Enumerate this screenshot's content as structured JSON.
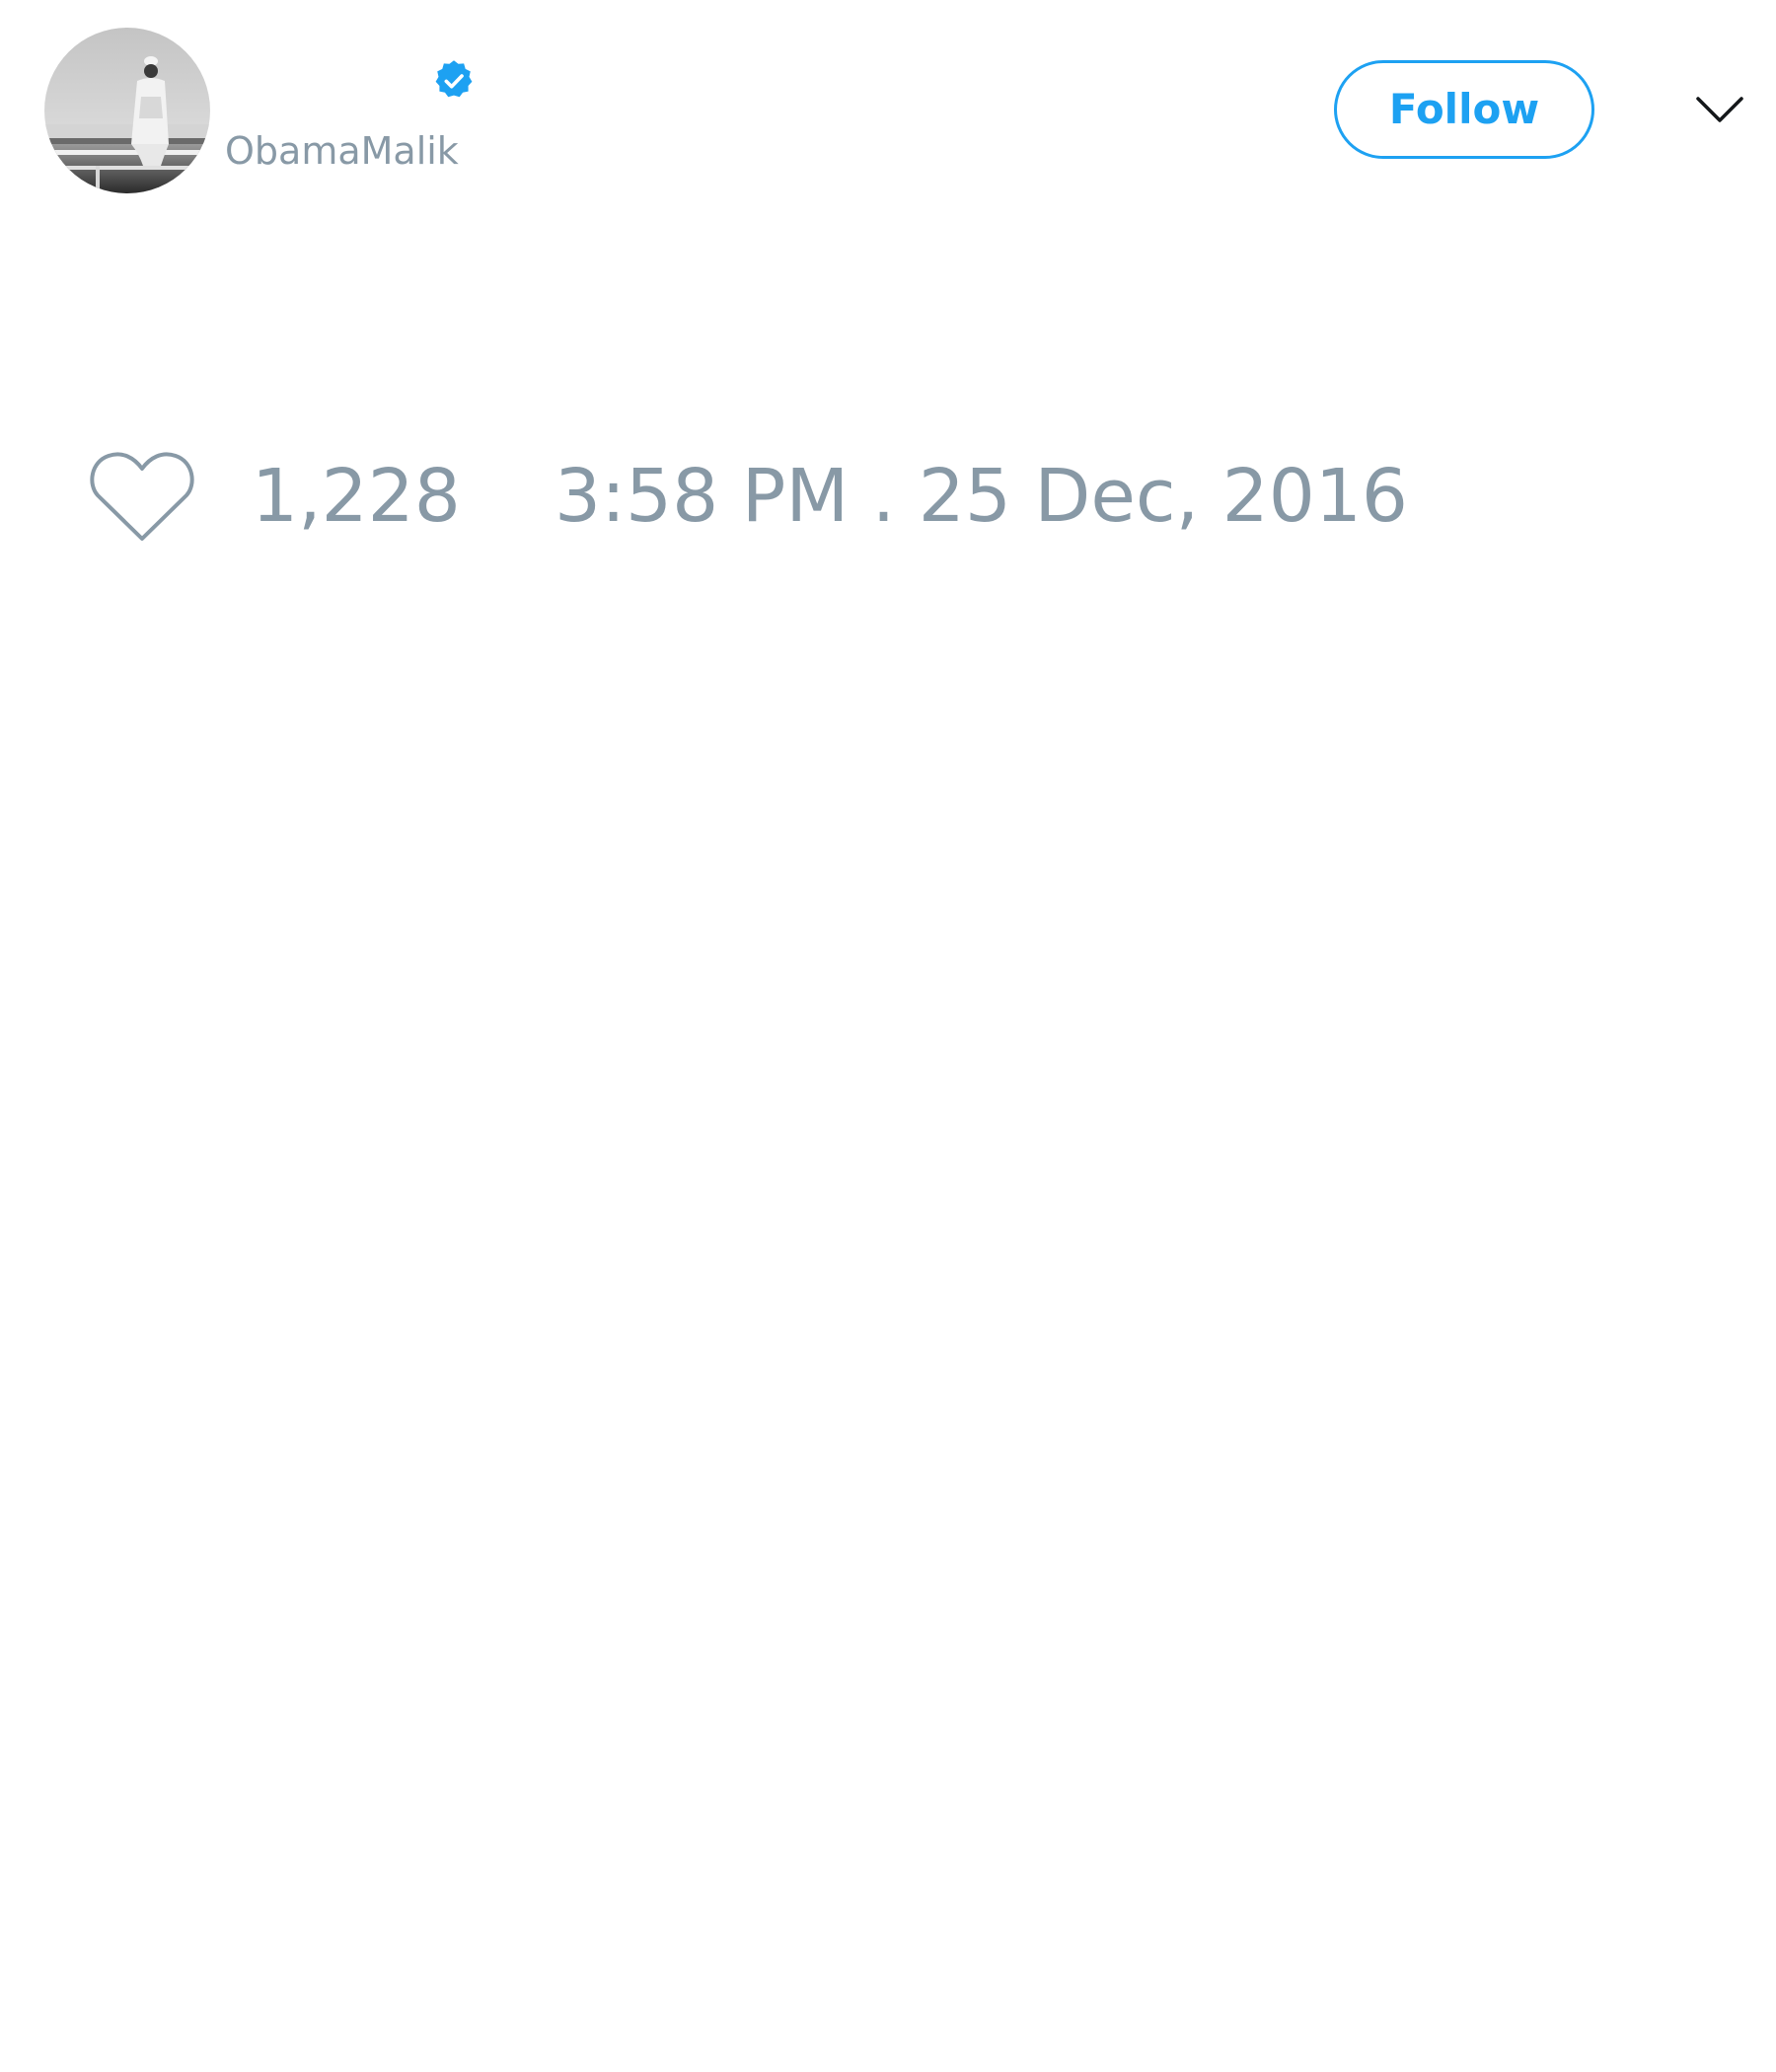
{
  "tweet": {
    "author": {
      "handle": "ObamaMalik",
      "verified": true,
      "avatar_icon": "profile-photo-icon"
    },
    "follow_label": "Follow",
    "likes_count": "1,228",
    "timestamp": "3:58 PM . 25 Dec, 2016"
  },
  "icons": {
    "verified": "verified-badge-icon",
    "caret": "chevron-down-icon",
    "like": "heart-icon"
  },
  "colors": {
    "accent": "#1da1f2",
    "muted": "#8899a6",
    "background": "#ffffff",
    "caret": "#14171a"
  }
}
